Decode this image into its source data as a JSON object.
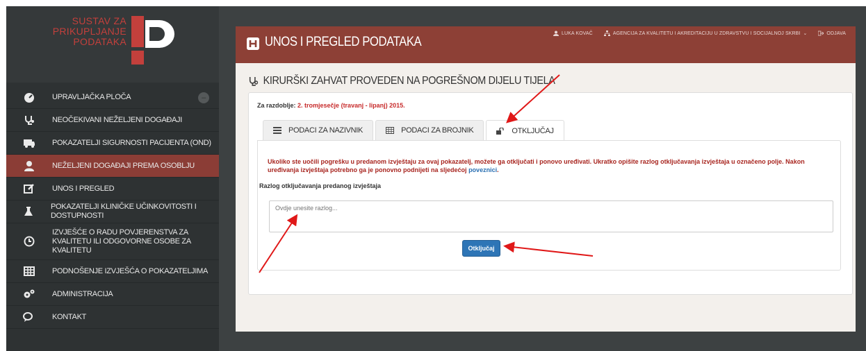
{
  "logo": {
    "line1": "SUSTAV ZA",
    "line2": "PRIKUPLJANJE",
    "line3": "PODATAKA",
    "brand_color": "#c3403c"
  },
  "sidebar": {
    "items": [
      {
        "label": "UPRAVLJAČKA PLOČA",
        "icon": "dashboard-icon"
      },
      {
        "label": "NEOČEKIVANI NEŽELJENI DOGAĐAJI",
        "icon": "stethoscope-icon"
      },
      {
        "label": "POKAZATELJI SIGURNOSTI PACIJENTA (OND)",
        "icon": "ambulance-icon"
      },
      {
        "label": "NEŽELJENI DOGAĐAJI PREMA OSOBLJU",
        "icon": "user-md-icon"
      },
      {
        "label": "UNOS I PREGLED",
        "icon": "edit-icon"
      },
      {
        "label": "POKAZATELJI KLINIČKE UČINKOVITOSTI I DOSTUPNOSTI",
        "icon": "flask-icon"
      },
      {
        "label": "IZVJEŠĆE O RADU POVJERENSTVA ZA KVALITETU ILI ODGOVORNE OSOBE ZA KVALITETU",
        "icon": "clock-icon"
      },
      {
        "label": "PODNOŠENJE IZVJEŠĆA O POKAZATELJIMA",
        "icon": "table-icon"
      },
      {
        "label": "ADMINISTRACIJA",
        "icon": "gears-icon"
      },
      {
        "label": "KONTAKT",
        "icon": "comments-icon"
      }
    ]
  },
  "header": {
    "title": "UNOS I PREGLED PODATAKA",
    "user": "LUKA KOVAČ",
    "agency": "AGENCIJA ZA KVALITETU I AKREDITACIJU U ZDRAVSTVU I SOCIJALNOJ SKRBI",
    "logout": "ODJAVA",
    "color": "#8d4036"
  },
  "page": {
    "title": "KIRURŠKI ZAHVAT PROVEDEN NA POGREŠNOM DIJELU TIJELA"
  },
  "period": {
    "label": "Za razdoblje:",
    "value": "2. tromjesečje (travanj - lipanj) 2015."
  },
  "tabs": [
    {
      "label": "PODACI ZA NAZIVNIK",
      "icon": "list-icon"
    },
    {
      "label": "PODACI ZA BROJNIK",
      "icon": "table-icon"
    },
    {
      "label": "OTKLJUČAJ",
      "icon": "unlock-icon"
    }
  ],
  "unlock": {
    "warning_text": "Ukoliko ste uočili pogrešku u predanom izvještaju za ovaj pokazatelj, možete ga otključati i ponovo uređivati. Ukratko opišite razlog otključavanja izvještaja u označeno polje. Nakon uređivanja izvještaja potrebno ga je ponovno podnijeti na sljedećoj ",
    "link_text": "poveznici",
    "after_link": ".",
    "reason_label": "Razlog otključavanja predanog izvještaja",
    "reason_placeholder": "Ovdje unesite razlog...",
    "button_label": "Otključaj"
  }
}
